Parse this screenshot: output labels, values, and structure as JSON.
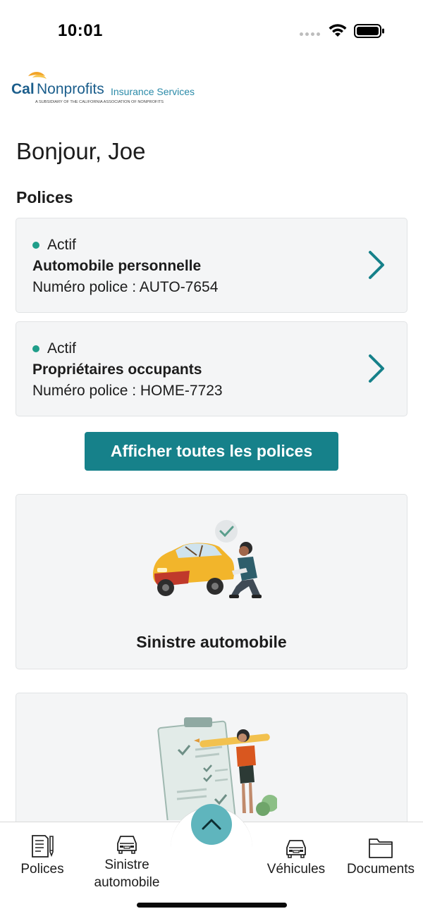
{
  "status_bar": {
    "time": "10:01"
  },
  "logo": {
    "brand_part1": "Cal",
    "brand_part2": "Nonprofits",
    "brand_part3": "Insurance Services",
    "tagline": "A SUBSIDIARY OF THE CALIFORNIA ASSOCIATION OF NONPROFITS"
  },
  "greeting": "Bonjour, Joe",
  "policies_section": {
    "title": "Polices",
    "items": [
      {
        "status": "Actif",
        "type": "Automobile personnelle",
        "number": "Numéro police : AUTO-7654"
      },
      {
        "status": "Actif",
        "type": "Propriétaires occupants",
        "number": "Numéro police : HOME-7723"
      }
    ],
    "view_all_label": "Afficher toutes les polices"
  },
  "feature_cards": [
    {
      "label": "Sinistre automobile"
    },
    {
      "label": ""
    }
  ],
  "tab_bar": {
    "tabs": [
      {
        "label": "Polices",
        "icon": "document-pen-icon"
      },
      {
        "label": "Sinistre automobile",
        "icon": "car-icon"
      },
      {
        "label": "",
        "icon": "chevron-up-icon"
      },
      {
        "label": "Véhicules",
        "icon": "car-icon"
      },
      {
        "label": "Documents",
        "icon": "folder-icon"
      }
    ]
  },
  "colors": {
    "accent": "#16818a",
    "active_dot": "#1f9e8a",
    "card_bg": "#f4f5f6",
    "center_button": "#5fb5bd"
  }
}
